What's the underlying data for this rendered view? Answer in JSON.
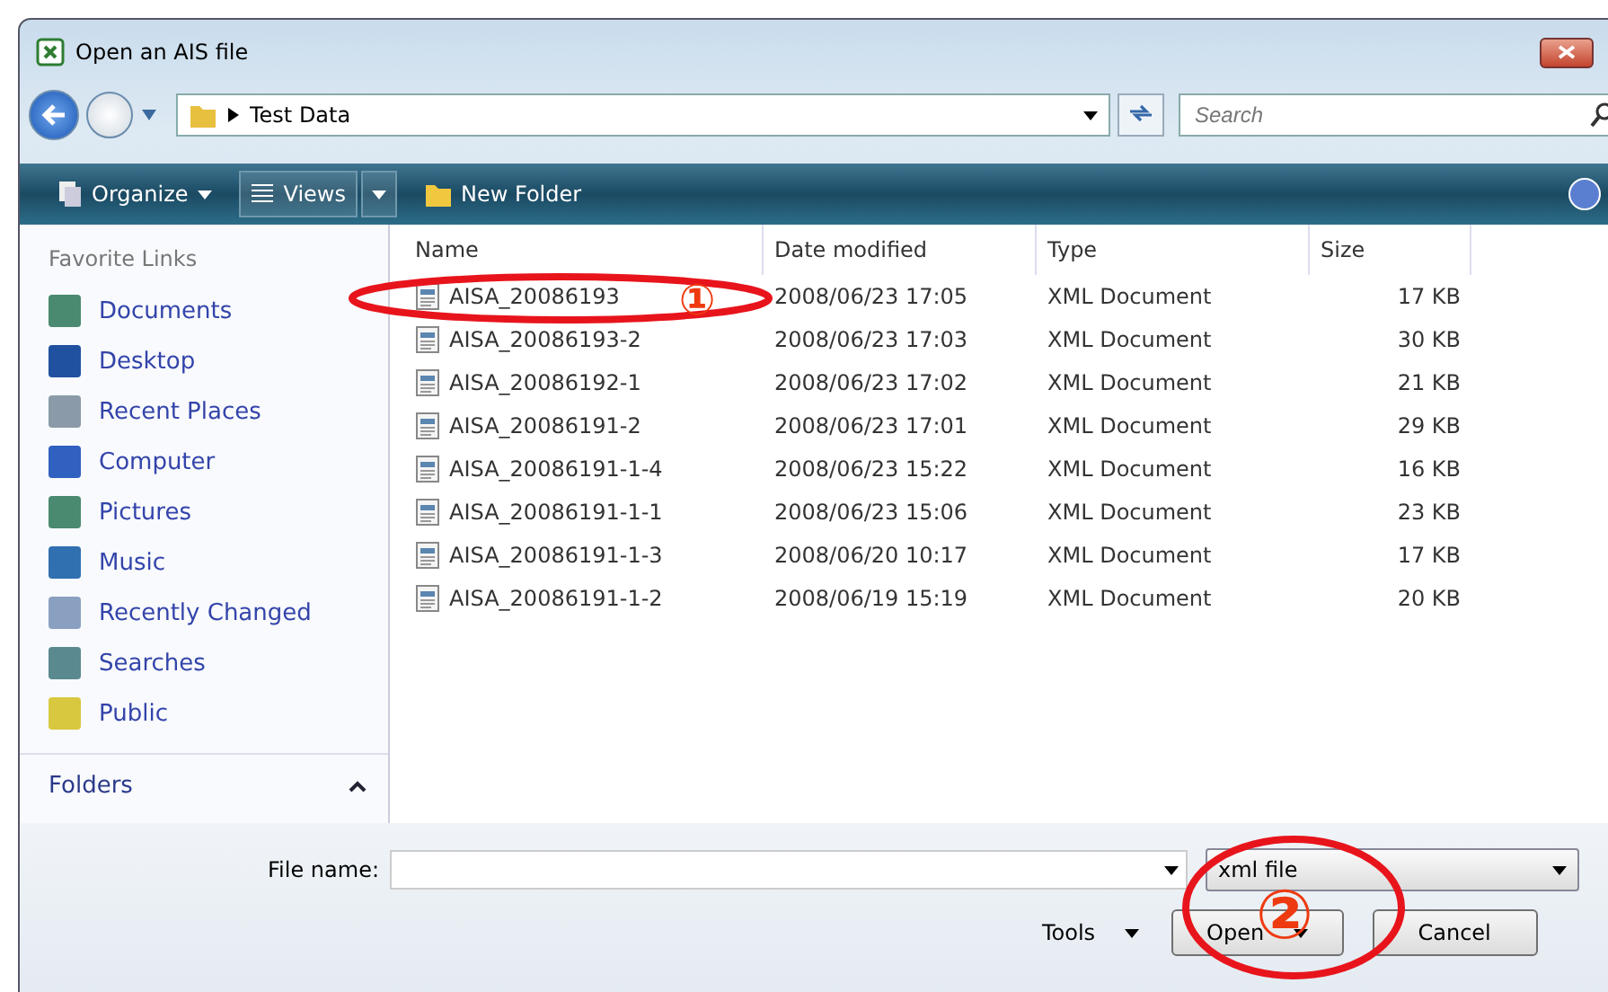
{
  "window": {
    "title": "Open an AIS file"
  },
  "address": {
    "path": "Test Data",
    "search_placeholder": "Search"
  },
  "toolbar": {
    "organize": "Organize",
    "views": "Views",
    "new_folder": "New Folder"
  },
  "sidebar": {
    "heading": "Favorite Links",
    "items": [
      "Documents",
      "Desktop",
      "Recent Places",
      "Computer",
      "Pictures",
      "Music",
      "Recently Changed",
      "Searches",
      "Public"
    ],
    "folders": "Folders"
  },
  "table": {
    "columns": [
      "Name",
      "Date modified",
      "Type",
      "Size"
    ],
    "rows": [
      {
        "name": "AISA_20086193",
        "date": "2008/06/23 17:05",
        "type": "XML Document",
        "size": "17 KB"
      },
      {
        "name": "AISA_20086193-2",
        "date": "2008/06/23 17:03",
        "type": "XML Document",
        "size": "30 KB"
      },
      {
        "name": "AISA_20086192-1",
        "date": "2008/06/23 17:02",
        "type": "XML Document",
        "size": "21 KB"
      },
      {
        "name": "AISA_20086191-2",
        "date": "2008/06/23 17:01",
        "type": "XML Document",
        "size": "29 KB"
      },
      {
        "name": "AISA_20086191-1-4",
        "date": "2008/06/23 15:22",
        "type": "XML Document",
        "size": "16 KB"
      },
      {
        "name": "AISA_20086191-1-1",
        "date": "2008/06/23 15:06",
        "type": "XML Document",
        "size": "23 KB"
      },
      {
        "name": "AISA_20086191-1-3",
        "date": "2008/06/20 10:17",
        "type": "XML Document",
        "size": "17 KB"
      },
      {
        "name": "AISA_20086191-1-2",
        "date": "2008/06/19 15:19",
        "type": "XML Document",
        "size": "20 KB"
      }
    ]
  },
  "bottom": {
    "file_name_label": "File name:",
    "filter": "xml file",
    "tools": "Tools",
    "open": "Open",
    "cancel": "Cancel"
  },
  "annotations": [
    {
      "number": "①"
    },
    {
      "number": "②"
    }
  ]
}
